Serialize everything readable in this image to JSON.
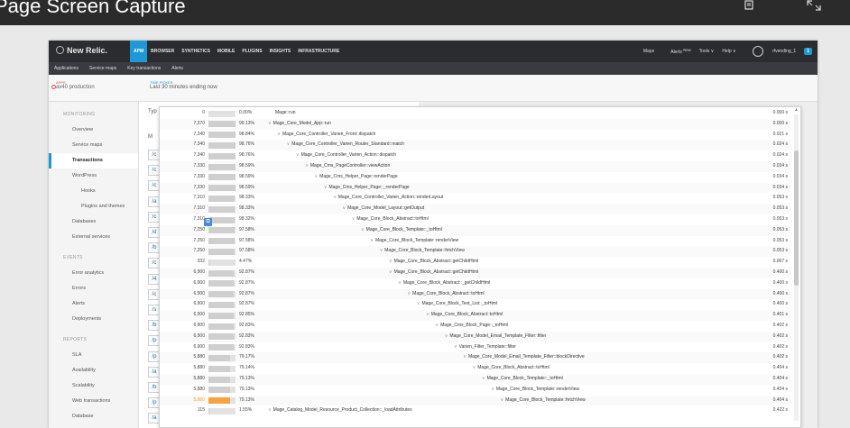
{
  "viewer": {
    "title": "Page Screen Capture",
    "copy_icon": "copy-icon",
    "expand_icon": "expand-icon"
  },
  "newrelic": {
    "logo": "New Relic.",
    "nav": [
      "APM",
      "BROWSER",
      "SYNTHETICS",
      "MOBILE",
      "PLUGINS",
      "INSIGHTS",
      "INFRASTRUCTURE"
    ],
    "right": {
      "maps": "Maps",
      "alerts": "Alerts",
      "alerts_new": "New",
      "tools": "Tools ∨",
      "help": "Help ∨",
      "user": "rfvending_1",
      "badge": "1"
    },
    "subnav": [
      "Applications",
      "Service maps",
      "Key transactions",
      "Alerts"
    ],
    "apps_label": "APPS",
    "apps_value": "av40 production",
    "time_label": "TIME PICKER",
    "time_value": "Last 30 minutes ending now",
    "content_label_type": "Typ",
    "content_label_m": "M"
  },
  "sidebar": {
    "monitoring_head": "MONITORING",
    "items_monitoring": [
      "Overview",
      "Service maps",
      "Transactions",
      "WordPress",
      "Hooks",
      "Plugins and themes",
      "Databases",
      "External services"
    ],
    "events_head": "EVENTS",
    "items_events": [
      "Error analytics",
      "Errors",
      "Alerts",
      "Deployments"
    ],
    "reports_head": "REPORTS",
    "items_reports": [
      "SLA",
      "Availability",
      "Scalability",
      "Web transactions",
      "Database"
    ]
  },
  "left_stubs": [
    "/c",
    "/c",
    "/c",
    "/a",
    "/c",
    "/d",
    "/b",
    "/c",
    "/4",
    "/c",
    "/s",
    "/b",
    "/p",
    "/p",
    "/a",
    "/b",
    "/p",
    "/a"
  ],
  "trace": {
    "rows": [
      {
        "count": "0",
        "pct": "0.00%",
        "fill": 0.0,
        "name": "Mage::run",
        "depth": 0,
        "chev": false,
        "time": "0.000 s"
      },
      {
        "count": "7,370",
        "pct": "99.13%",
        "fill": 0.99,
        "name": "Mage_Core_Model_App::run",
        "depth": 0,
        "chev": true,
        "time": "0.000 s"
      },
      {
        "count": "7,340",
        "pct": "98.84%",
        "fill": 0.99,
        "name": "Mage_Core_Controller_Varien_Front::dispatch",
        "depth": 1,
        "chev": true,
        "time": "0.021 s"
      },
      {
        "count": "7,340",
        "pct": "98.76%",
        "fill": 0.99,
        "name": "Mage_Core_Controller_Varien_Router_Standard::match",
        "depth": 2,
        "chev": true,
        "time": "0.024 s"
      },
      {
        "count": "7,340",
        "pct": "98.76%",
        "fill": 0.99,
        "name": "Mage_Core_Controller_Varien_Action::dispatch",
        "depth": 3,
        "chev": true,
        "time": "0.024 s"
      },
      {
        "count": "7,330",
        "pct": "98.59%",
        "fill": 0.99,
        "name": "Mage_Cms_PageController::viewAction",
        "depth": 4,
        "chev": true,
        "time": "0.034 s"
      },
      {
        "count": "7,330",
        "pct": "98.59%",
        "fill": 0.99,
        "name": "Mage_Cms_Helper_Page::renderPage",
        "depth": 5,
        "chev": true,
        "time": "0.034 s"
      },
      {
        "count": "7,330",
        "pct": "98.59%",
        "fill": 0.99,
        "name": "Mage_Cms_Helper_Page::_renderPage",
        "depth": 6,
        "chev": true,
        "time": "0.034 s"
      },
      {
        "count": "7,310",
        "pct": "98.33%",
        "fill": 0.98,
        "name": "Mage_Core_Controller_Varien_Action::renderLayout",
        "depth": 7,
        "chev": true,
        "time": "0.053 s"
      },
      {
        "count": "7,310",
        "pct": "98.33%",
        "fill": 0.98,
        "name": "Mage_Core_Model_Layout::getOutput",
        "depth": 8,
        "chev": true,
        "time": "0.053 s"
      },
      {
        "count": "7,310",
        "pct": "98.32%",
        "fill": 0.98,
        "name": "Mage_Core_Block_Abstract::toHtml",
        "depth": 9,
        "chev": true,
        "time": "0.053 s"
      },
      {
        "count": "7,250",
        "pct": "97.58%",
        "fill": 0.98,
        "name": "Mage_Core_Block_Template::_toHtml",
        "depth": 10,
        "chev": true,
        "time": "0.053 s"
      },
      {
        "count": "7,250",
        "pct": "97.58%",
        "fill": 0.98,
        "name": "Mage_Core_Block_Template::renderView",
        "depth": 11,
        "chev": true,
        "time": "0.053 s"
      },
      {
        "count": "7,250",
        "pct": "97.58%",
        "fill": 0.98,
        "name": "Mage_Core_Block_Template::fetchView",
        "depth": 12,
        "chev": true,
        "time": "0.053 s"
      },
      {
        "count": "332",
        "pct": "4.47%",
        "fill": 0.045,
        "name": "Mage_Core_Block_Abstract::getChildHtml",
        "depth": 13,
        "chev": true,
        "time": "0.067 s"
      },
      {
        "count": "6,900",
        "pct": "92.87%",
        "fill": 0.93,
        "name": "Mage_Core_Block_Abstract::getChildHtml",
        "depth": 13,
        "chev": true,
        "time": "0.400 s"
      },
      {
        "count": "6,900",
        "pct": "92.87%",
        "fill": 0.93,
        "name": "Mage_Core_Block_Abstract::_getChildHtml",
        "depth": 14,
        "chev": true,
        "time": "0.400 s"
      },
      {
        "count": "6,900",
        "pct": "92.87%",
        "fill": 0.93,
        "name": "Mage_Core_Block_Abstract::toHtml",
        "depth": 15,
        "chev": true,
        "time": "0.400 s"
      },
      {
        "count": "6,900",
        "pct": "92.87%",
        "fill": 0.93,
        "name": "Mage_Core_Block_Text_List::_toHtml",
        "depth": 16,
        "chev": true,
        "time": "0.400 s"
      },
      {
        "count": "6,900",
        "pct": "92.85%",
        "fill": 0.93,
        "name": "Mage_Core_Block_Abstract::toHtml",
        "depth": 17,
        "chev": true,
        "time": "0.401 s"
      },
      {
        "count": "6,900",
        "pct": "92.83%",
        "fill": 0.93,
        "name": "Mage_Cms_Block_Page::_toHtml",
        "depth": 18,
        "chev": true,
        "time": "0.402 s"
      },
      {
        "count": "6,900",
        "pct": "92.83%",
        "fill": 0.93,
        "name": "Mage_Core_Model_Email_Template_Filter::filter",
        "depth": 19,
        "chev": true,
        "time": "0.402 s"
      },
      {
        "count": "6,900",
        "pct": "92.83%",
        "fill": 0.93,
        "name": "Varien_Filter_Template::filter",
        "depth": 20,
        "chev": true,
        "time": "0.402 s"
      },
      {
        "count": "5,880",
        "pct": "79.17%",
        "fill": 0.79,
        "name": "Mage_Core_Model_Email_Template_Filter::blockDirective",
        "depth": 21,
        "chev": true,
        "time": "0.402 s"
      },
      {
        "count": "5,880",
        "pct": "79.14%",
        "fill": 0.79,
        "name": "Mage_Core_Block_Abstract::toHtml",
        "depth": 22,
        "chev": true,
        "time": "0.404 s"
      },
      {
        "count": "5,880",
        "pct": "79.13%",
        "fill": 0.79,
        "name": "Mage_Core_Block_Template::_toHtml",
        "depth": 23,
        "chev": true,
        "time": "0.404 s"
      },
      {
        "count": "5,880",
        "pct": "79.13%",
        "fill": 0.79,
        "name": "Mage_Core_Block_Template::renderView",
        "depth": 24,
        "chev": true,
        "time": "0.404 s"
      },
      {
        "count": "5,880",
        "pct": "79.13%",
        "fill": 0.79,
        "name": "Mage_Core_Block_Template::fetchView",
        "depth": 25,
        "chev": true,
        "time": "0.404 s",
        "highlight": true
      },
      {
        "count": "115",
        "pct": "1.55%",
        "fill": 0.016,
        "name": "Mage_Catalog_Model_Resource_Product_Collection::_loadAttributes",
        "depth": 0,
        "chev": true,
        "time": "0.422 s"
      }
    ]
  }
}
